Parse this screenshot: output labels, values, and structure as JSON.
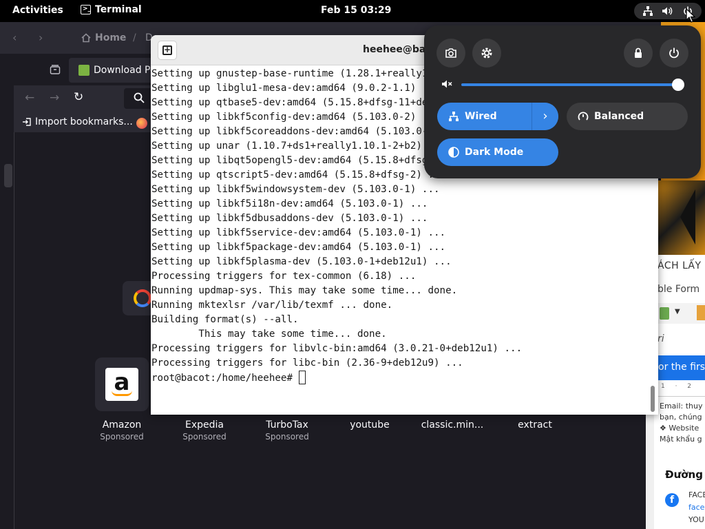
{
  "topbar": {
    "activities": "Activities",
    "app_name": "Terminal",
    "clock": "Feb 15  03:29",
    "icons": [
      "network-wired-icon",
      "volume-icon",
      "power-icon"
    ]
  },
  "browser_back": {
    "home": "Home",
    "path_part": "D"
  },
  "firefox": {
    "tab_label": "Download Pe",
    "import_bookmarks": "Import bookmarks...",
    "shortcuts": [
      {
        "name": "Amazon",
        "sponsored": "Sponsored"
      },
      {
        "name": "Expedia",
        "sponsored": "Sponsored"
      },
      {
        "name": "TurboTax",
        "sponsored": "Sponsored"
      },
      {
        "name": "youtube",
        "sponsored": ""
      },
      {
        "name": "classic.min...",
        "sponsored": ""
      },
      {
        "name": "extract",
        "sponsored": ""
      }
    ]
  },
  "right_app": {
    "title": "ÁCH LẤY M",
    "tabs": "ble   Form",
    "font_field": "ri",
    "banner": "or the first t",
    "ruler": "1 · 2",
    "doc_lines": [
      "Email: thuy",
      "bạn, chúng",
      "",
      "❖ Website",
      "Mật khẩu g"
    ],
    "heading": "Đường l",
    "fb_line1": "FACE",
    "fb_line2": "faceb",
    "fb_line3": "YOU"
  },
  "terminal": {
    "title": "heehee@bacot: /home/heehee",
    "lines": [
      "Setting up gnustep-base-runtime (1.28.1+really1.28.1-4) ...",
      "Setting up libglu1-mesa-dev:amd64 (9.0.2-1.1) ...",
      "Setting up qtbase5-dev:amd64 (5.15.8+dfsg-11+deb12u3) ...",
      "Setting up libkf5config-dev:amd64 (5.103.0-2) ...",
      "Setting up libkf5coreaddons-dev:amd64 (5.103.0-1) ...",
      "Setting up unar (1.10.7+ds1+really1.10.1-2+b2) ...",
      "Setting up libqt5opengl5-dev:amd64 (5.15.8+dfsg-11+deb12u3) ...",
      "Setting up qtscript5-dev:amd64 (5.15.8+dfsg-2) ...",
      "Setting up libkf5windowsystem-dev (5.103.0-1) ...",
      "Setting up libkf5i18n-dev:amd64 (5.103.0-1) ...",
      "Setting up libkf5dbusaddons-dev (5.103.0-1) ...",
      "Setting up libkf5service-dev:amd64 (5.103.0-1) ...",
      "Setting up libkf5package-dev:amd64 (5.103.0-1) ...",
      "Setting up libkf5plasma-dev (5.103.0-1+deb12u1) ...",
      "Processing triggers for tex-common (6.18) ...",
      "Running updmap-sys. This may take some time... done.",
      "Running mktexlsr /var/lib/texmf ... done.",
      "Building format(s) --all.",
      "        This may take some time... done.",
      "Processing triggers for libvlc-bin:amd64 (3.0.21-0+deb12u1) ...",
      "Processing triggers for libc-bin (2.36-9+deb12u9) ..."
    ],
    "prompt": "root@bacot:/home/heehee# "
  },
  "quick_settings": {
    "volume_level": 1.0,
    "wired_label": "Wired",
    "power_mode_label": "Balanced",
    "dark_mode_label": "Dark Mode",
    "accent_color": "#3584e4"
  }
}
